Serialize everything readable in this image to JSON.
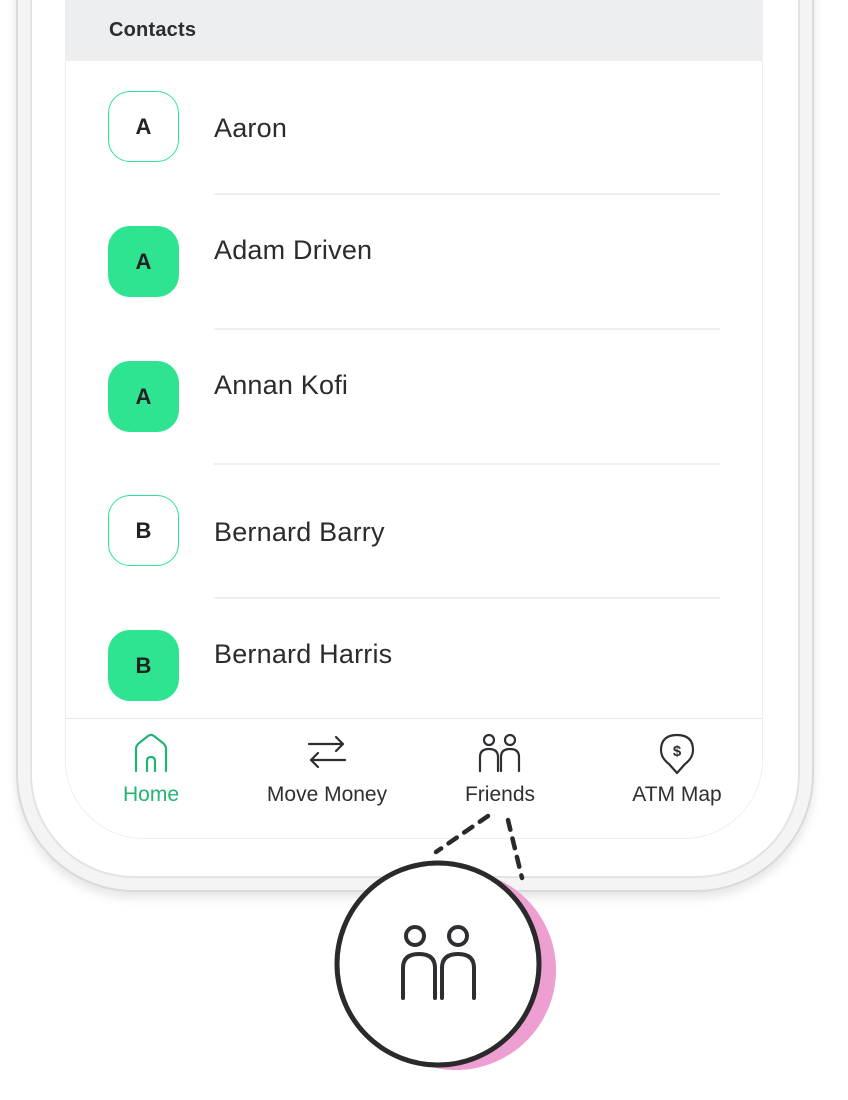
{
  "section": {
    "title": "Contacts"
  },
  "contacts": [
    {
      "initial": "A",
      "name": "Aaron",
      "style": "outline"
    },
    {
      "initial": "A",
      "name": "Adam Driven",
      "style": "filled"
    },
    {
      "initial": "A",
      "name": "Annan Kofi",
      "style": "filled"
    },
    {
      "initial": "B",
      "name": "Bernard Barry",
      "style": "outline"
    },
    {
      "initial": "B",
      "name": "Bernard Harris",
      "style": "filled"
    }
  ],
  "tabs": [
    {
      "label": "Home",
      "icon": "home-icon",
      "active": true
    },
    {
      "label": "Move Money",
      "icon": "transfer-arrows-icon",
      "active": false
    },
    {
      "label": "Friends",
      "icon": "friends-icon",
      "active": false
    },
    {
      "label": "ATM Map",
      "icon": "atm-location-icon",
      "active": false
    }
  ],
  "colors": {
    "accent_green": "#2ee491",
    "active_tab_green": "#1fb572",
    "callout_pink": "#ee9fd2",
    "header_gray": "#eceef0"
  }
}
